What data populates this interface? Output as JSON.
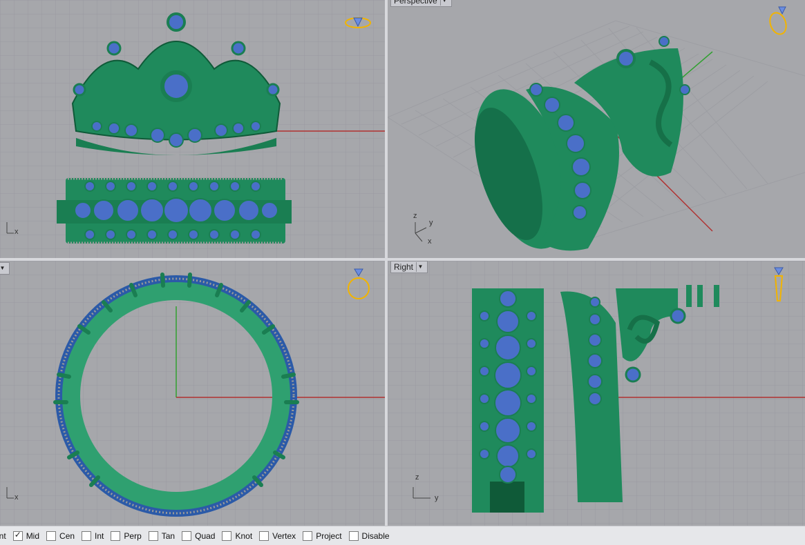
{
  "viewports": {
    "top": {
      "title": ""
    },
    "perspective": {
      "title": "Perspective"
    },
    "front": {
      "title": ""
    },
    "right": {
      "title": "Right"
    }
  },
  "axis_labels": {
    "x": "x",
    "y": "y",
    "z": "z"
  },
  "osnap": {
    "items": [
      {
        "label": "int",
        "checked": false
      },
      {
        "label": "Mid",
        "checked": true
      },
      {
        "label": "Cen",
        "checked": false
      },
      {
        "label": "Int",
        "checked": false
      },
      {
        "label": "Perp",
        "checked": false
      },
      {
        "label": "Tan",
        "checked": false
      },
      {
        "label": "Quad",
        "checked": false
      },
      {
        "label": "Knot",
        "checked": false
      },
      {
        "label": "Vertex",
        "checked": false
      },
      {
        "label": "Project",
        "checked": false
      },
      {
        "label": "Disable",
        "checked": false
      }
    ]
  },
  "colors": {
    "metal": "#1f8a5c",
    "gem": "#4a6fc8",
    "grid": "#9a9ba0",
    "axis_x": "#b03030",
    "axis_y": "#30a030",
    "highlight": "#f2b400"
  }
}
